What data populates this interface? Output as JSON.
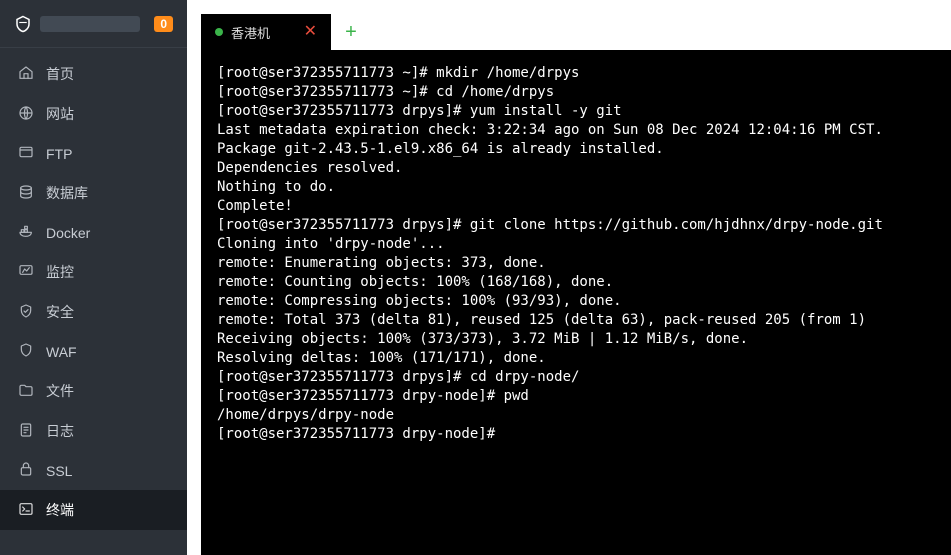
{
  "badge": "0",
  "nav": [
    {
      "id": "home",
      "label": "首页",
      "icon": "home"
    },
    {
      "id": "site",
      "label": "网站",
      "icon": "globe"
    },
    {
      "id": "ftp",
      "label": "FTP",
      "icon": "ftp"
    },
    {
      "id": "db",
      "label": "数据库",
      "icon": "db"
    },
    {
      "id": "docker",
      "label": "Docker",
      "icon": "docker"
    },
    {
      "id": "monitor",
      "label": "监控",
      "icon": "monitor"
    },
    {
      "id": "security",
      "label": "安全",
      "icon": "shield"
    },
    {
      "id": "waf",
      "label": "WAF",
      "icon": "waf"
    },
    {
      "id": "files",
      "label": "文件",
      "icon": "folder"
    },
    {
      "id": "logs",
      "label": "日志",
      "icon": "logs"
    },
    {
      "id": "ssl",
      "label": "SSL",
      "icon": "ssl"
    },
    {
      "id": "terminal",
      "label": "终端",
      "icon": "terminal"
    }
  ],
  "active_nav": "terminal",
  "tab": {
    "label": "香港机"
  },
  "terminal_lines": [
    "[root@ser372355711773 ~]# mkdir /home/drpys",
    "[root@ser372355711773 ~]# cd /home/drpys",
    "[root@ser372355711773 drpys]# yum install -y git",
    "Last metadata expiration check: 3:22:34 ago on Sun 08 Dec 2024 12:04:16 PM CST.",
    "Package git-2.43.5-1.el9.x86_64 is already installed.",
    "Dependencies resolved.",
    "Nothing to do.",
    "Complete!",
    "[root@ser372355711773 drpys]# git clone https://github.com/hjdhnx/drpy-node.git",
    "Cloning into 'drpy-node'...",
    "remote: Enumerating objects: 373, done.",
    "remote: Counting objects: 100% (168/168), done.",
    "remote: Compressing objects: 100% (93/93), done.",
    "remote: Total 373 (delta 81), reused 125 (delta 63), pack-reused 205 (from 1)",
    "Receiving objects: 100% (373/373), 3.72 MiB | 1.12 MiB/s, done.",
    "Resolving deltas: 100% (171/171), done.",
    "[root@ser372355711773 drpys]# cd drpy-node/",
    "[root@ser372355711773 drpy-node]# pwd",
    "/home/drpys/drpy-node",
    "[root@ser372355711773 drpy-node]# "
  ]
}
